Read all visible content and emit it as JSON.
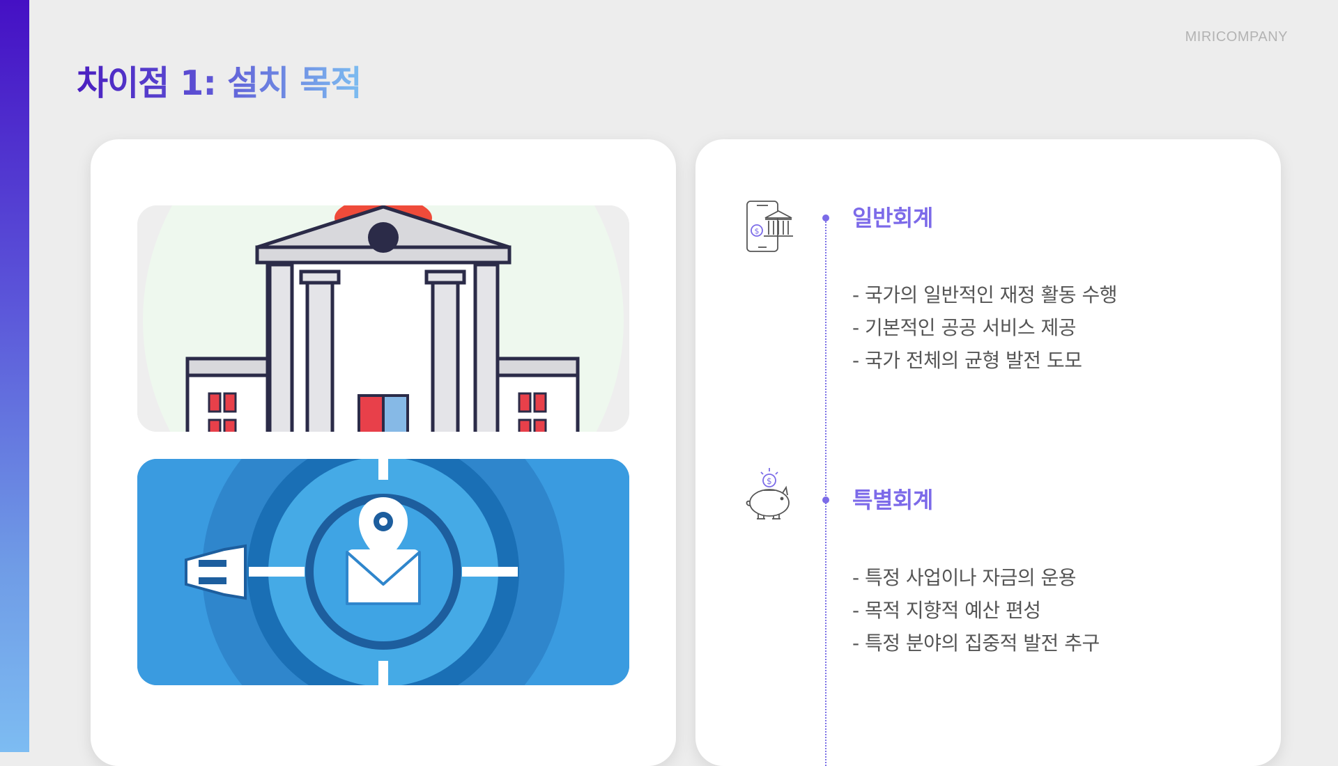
{
  "header": {
    "title": "차이점 1: 설치 목적",
    "brand": "MIRICOMPANY"
  },
  "colors": {
    "accent_purple": "#4a1fc0",
    "accent_blue": "#7dbdf0",
    "section_title": "#7c6ae9",
    "timeline": "#7b70e6"
  },
  "images": [
    {
      "icon": "government-building-illustration"
    },
    {
      "icon": "target-location-illustration"
    }
  ],
  "sections": [
    {
      "title": "일반회계",
      "icon": "mobile-bank-icon",
      "bullets": [
        "- 국가의 일반적인 재정 활동 수행",
        "- 기본적인 공공 서비스 제공",
        "- 국가 전체의 균형 발전 도모"
      ]
    },
    {
      "title": "특별회계",
      "icon": "piggy-bank-icon",
      "bullets": [
        "- 특정 사업이나 자금의 운용",
        "- 목적 지향적 예산 편성",
        "- 특정 분야의 집중적 발전 추구"
      ]
    }
  ]
}
